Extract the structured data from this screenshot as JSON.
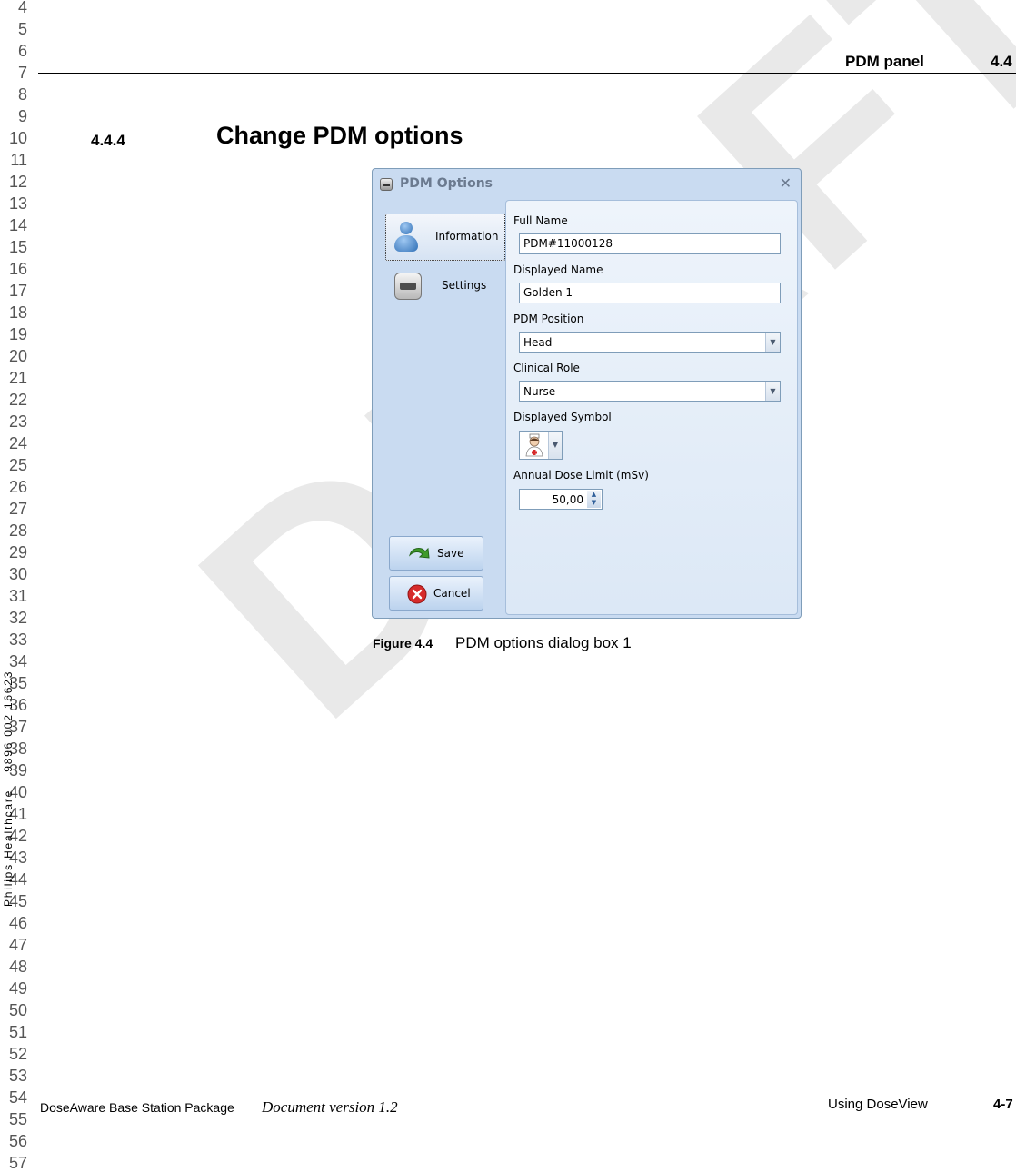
{
  "line_numbers": [
    "4",
    "5",
    "6",
    "7",
    "8",
    "9",
    "10",
    "11",
    "12",
    "13",
    "14",
    "15",
    "16",
    "17",
    "18",
    "19",
    "20",
    "21",
    "22",
    "23",
    "24",
    "25",
    "26",
    "27",
    "28",
    "29",
    "30",
    "31",
    "32",
    "33",
    "34",
    "35",
    "36",
    "37",
    "38",
    "39",
    "40",
    "41",
    "42",
    "43",
    "44",
    "45",
    "46",
    "47",
    "48",
    "49",
    "50",
    "51",
    "52",
    "53",
    "54",
    "55",
    "56",
    "57"
  ],
  "side_label": {
    "company": "Philips Healthcare",
    "doc_code": "9896 002 16623"
  },
  "watermark": "DRAFT",
  "header": {
    "chapter": "PDM panel",
    "number": "4.4"
  },
  "section": {
    "number": "4.4.4",
    "title": "Change PDM options"
  },
  "dialog": {
    "title": "PDM Options",
    "nav": {
      "information": "Information",
      "settings": "Settings"
    },
    "buttons": {
      "save": "Save",
      "cancel": "Cancel"
    },
    "fields": {
      "full_name_label": "Full Name",
      "full_name_value": "PDM#11000128",
      "displayed_name_label": "Displayed Name",
      "displayed_name_value": "Golden 1",
      "position_label": "PDM Position",
      "position_value": "Head",
      "role_label": "Clinical Role",
      "role_value": "Nurse",
      "symbol_label": "Displayed Symbol",
      "symbol_icon": "nurse-icon",
      "dose_label": "Annual Dose Limit (mSv)",
      "dose_value": "50,00"
    }
  },
  "figure": {
    "label": "Figure 4.4",
    "caption": "PDM options dialog box 1"
  },
  "footer": {
    "product": "DoseAware Base Station Package",
    "version": "Document version 1.2",
    "section": "Using DoseView",
    "page": "4-7"
  }
}
